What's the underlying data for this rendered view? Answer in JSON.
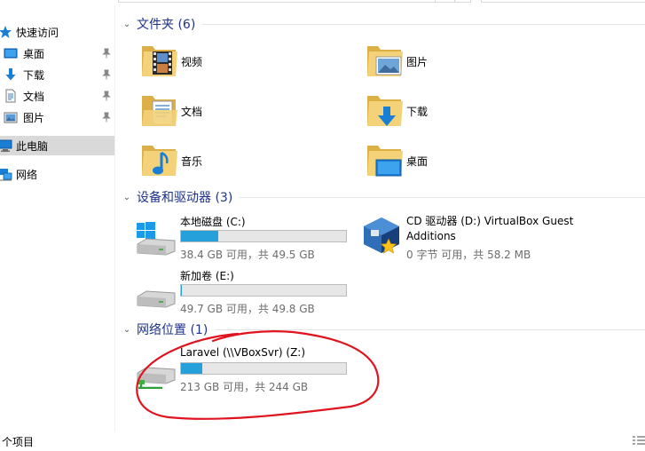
{
  "sidebar": {
    "items": [
      {
        "label": "快速访问"
      },
      {
        "label": "桌面"
      },
      {
        "label": "下载"
      },
      {
        "label": "文档"
      },
      {
        "label": "图片"
      },
      {
        "label": "此电脑"
      },
      {
        "label": "网络"
      }
    ]
  },
  "groups": {
    "folders": {
      "title": "文件夹 (6)"
    },
    "devices": {
      "title": "设备和驱动器 (3)"
    },
    "network": {
      "title": "网络位置 (1)"
    }
  },
  "folders": [
    {
      "name": "视频",
      "icon": "video-folder-icon"
    },
    {
      "name": "图片",
      "icon": "pictures-folder-icon"
    },
    {
      "name": "文档",
      "icon": "documents-folder-icon"
    },
    {
      "name": "下载",
      "icon": "downloads-folder-icon"
    },
    {
      "name": "音乐",
      "icon": "music-folder-icon"
    },
    {
      "name": "桌面",
      "icon": "desktop-folder-icon"
    }
  ],
  "drives": [
    {
      "name": "本地磁盘 (C:)",
      "info": "38.4 GB 可用，共 49.5 GB",
      "used_fraction": 0.224
    },
    {
      "name": "新加卷 (E:)",
      "info": "49.7 GB 可用，共 49.8 GB",
      "used_fraction": 0.002
    }
  ],
  "cd_drive": {
    "name": "CD 驱动器 (D:) VirtualBox Guest Additions",
    "info": "0 字节 可用，共 58.2 MB"
  },
  "network_drive": {
    "name": "Laravel (\\\\VBoxSvr) (Z:)",
    "info": "213 GB 可用，共 244 GB",
    "used_fraction": 0.127
  },
  "status": {
    "text": "个项目"
  },
  "colors": {
    "accent": "#1e3287",
    "bar_fill": "#26a0da",
    "annotation": "#e0141e"
  }
}
